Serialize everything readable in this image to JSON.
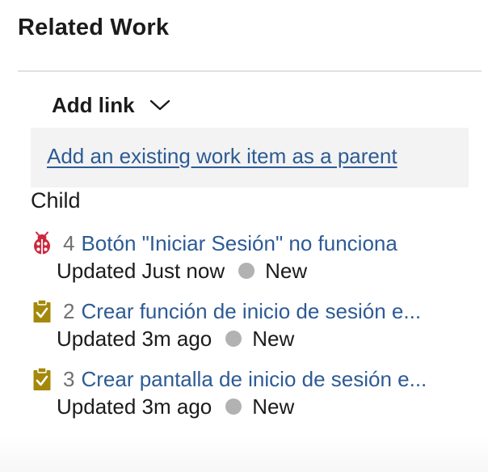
{
  "section": {
    "title": "Related Work"
  },
  "add_link": {
    "label": "Add link",
    "icon": "chevron-down-icon"
  },
  "parent": {
    "link_text": "Add an existing work item as a parent"
  },
  "group": {
    "label": "Child"
  },
  "items": [
    {
      "type_icon": "bug-icon",
      "id": "4",
      "title": "Botón \"Iniciar Sesión\" no funciona",
      "updated": "Updated Just now",
      "state": "New",
      "icon_color": "#cc293d"
    },
    {
      "type_icon": "task-icon",
      "id": "2",
      "title": "Crear función de inicio de sesión e...",
      "updated": "Updated 3m ago",
      "state": "New",
      "icon_color": "#a4880a"
    },
    {
      "type_icon": "task-icon",
      "id": "3",
      "title": "Crear pantalla de inicio de sesión e...",
      "updated": "Updated 3m ago",
      "state": "New",
      "icon_color": "#a4880a"
    }
  ],
  "colors": {
    "link": "#2d5b94",
    "state_new": "#b2b2b2",
    "parent_box_bg": "#f3f3f3"
  }
}
